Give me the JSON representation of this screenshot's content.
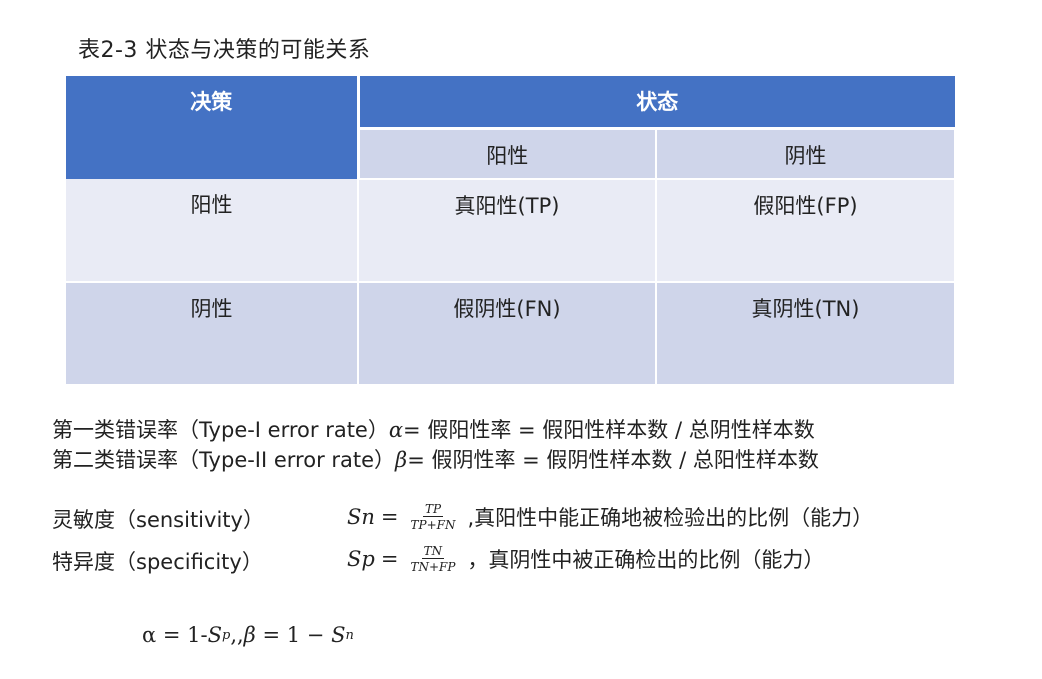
{
  "caption": "表2-3  状态与决策的可能关系",
  "table": {
    "header_decision": "决策",
    "header_state": "状态",
    "sub_positive": "阳性",
    "sub_negative": "阴性",
    "rows": [
      {
        "label": "阳性",
        "cells": [
          "真阳性(TP)",
          "假阳性(FP)"
        ]
      },
      {
        "label": "阴性",
        "cells": [
          "假阴性(FN)",
          "真阴性(TN)"
        ]
      }
    ],
    "colors": {
      "header": "#4472c4",
      "band_dark": "#cfd5ea",
      "band_light": "#e9ebf5"
    }
  },
  "errors": {
    "type1_prefix": "第一类错误率（Type-I error rate）",
    "type1_symbol": "α",
    "type1_def": "= 假阳性率 = 假阳性样本数 / 总阴性样本数",
    "type2_prefix": "第二类错误率（Type-II error rate）",
    "type2_symbol": "β",
    "type2_def": "= 假阴性率 = 假阴性样本数 / 总阳性样本数"
  },
  "sensitivity": {
    "label": "灵敏度（sensitivity）",
    "symbol": "Sn",
    "eq": "=",
    "numerator": "TP",
    "denominator": "TP+FN",
    "description": ",真阳性中能正确地被检验出的比例（能力）"
  },
  "specificity": {
    "label": "特异度（specificity）",
    "symbol": "Sp",
    "eq": "=",
    "numerator": "TN",
    "denominator": "TN+FP",
    "description": "，真阴性中被正确检出的比例（能力）"
  },
  "relation": {
    "alpha_part": "α = 1-",
    "s_letter": "S",
    "p_sub": "p",
    "separator": ",,",
    "beta_symbol": "β",
    "beta_part": " = 1 − ",
    "n_sub": "n"
  }
}
